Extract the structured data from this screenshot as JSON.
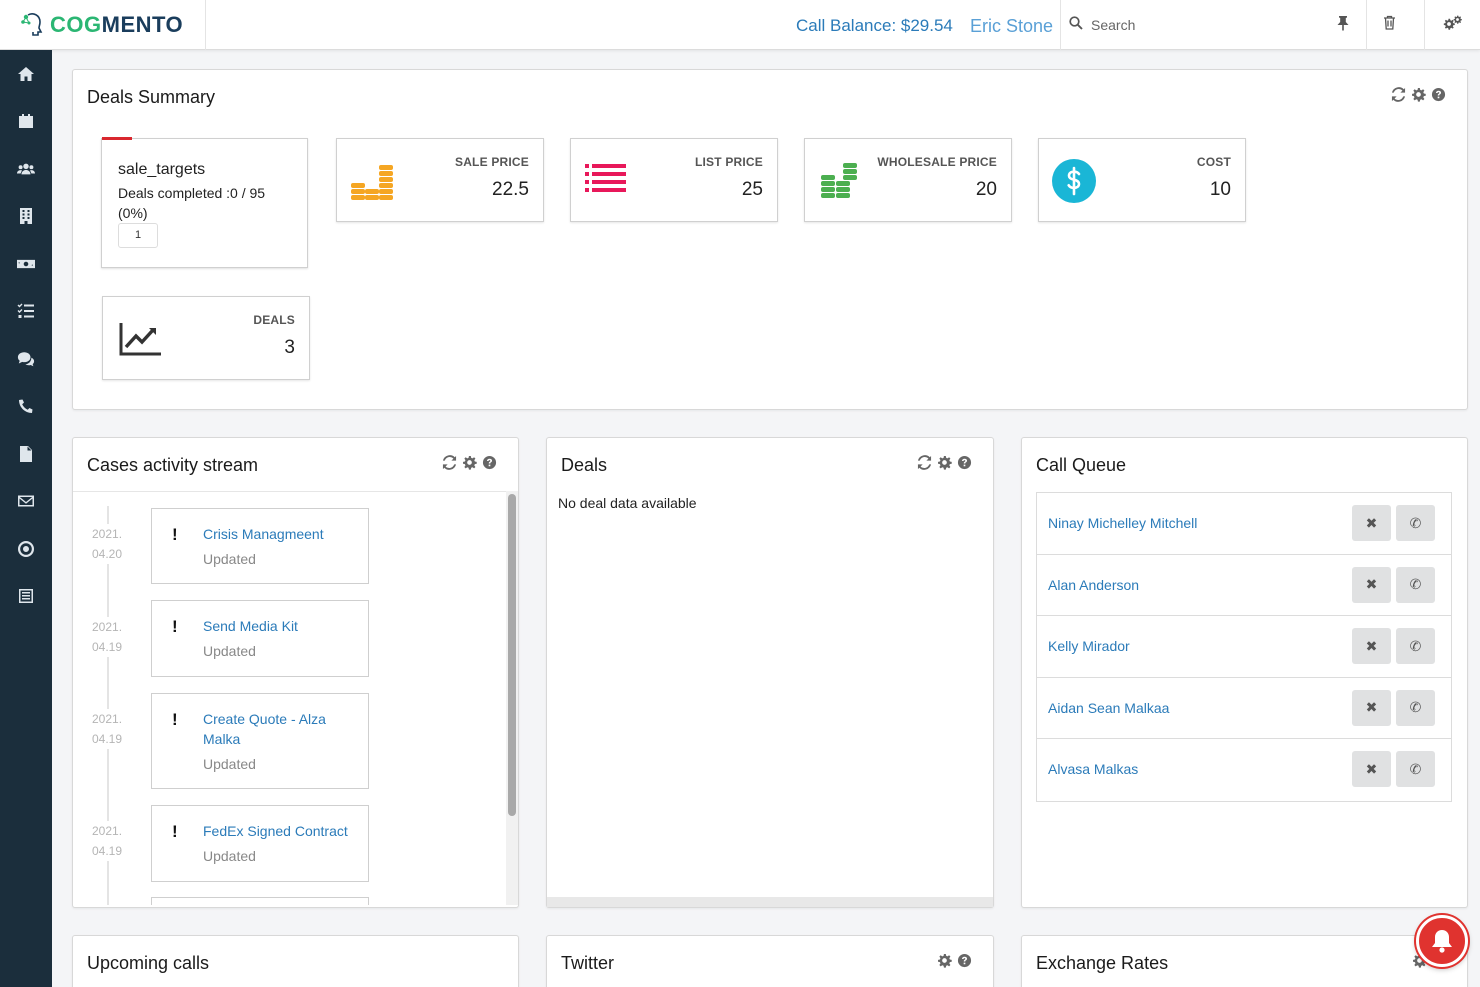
{
  "header": {
    "logo_cog": "COG",
    "logo_mento": "MENTO",
    "call_balance": "Call Balance: $29.54",
    "user_name": "Eric Stone",
    "search_placeholder": "Search"
  },
  "sidebar": {
    "items": [
      "home-icon",
      "calendar-icon",
      "contacts-icon",
      "companies-icon",
      "deals-icon",
      "tasks-icon",
      "cases-icon",
      "calls-icon",
      "documents-icon",
      "email-icon",
      "campaigns-icon",
      "forms-icon"
    ]
  },
  "deals_summary": {
    "title": "Deals Summary",
    "target": {
      "title": "sale_targets",
      "subtitle": "Deals completed :0 / 95 (0%)",
      "page": "1"
    },
    "cards": [
      {
        "label": "SALE PRICE",
        "value": "22.5",
        "icon": "coins-orange-icon"
      },
      {
        "label": "LIST PRICE",
        "value": "25",
        "icon": "list-icon"
      },
      {
        "label": "WHOLESALE PRICE",
        "value": "20",
        "icon": "coins-green-icon"
      },
      {
        "label": "COST",
        "value": "10",
        "icon": "dollar-circle-icon"
      },
      {
        "label": "DEALS",
        "value": "3",
        "icon": "line-chart-icon"
      }
    ],
    "colors": {
      "orange": "#f5a623",
      "pink": "#e8185a",
      "green": "#4caf50",
      "teal": "#1ab6d6"
    }
  },
  "cases_stream": {
    "title": "Cases activity stream",
    "items": [
      {
        "date_year": "2021.",
        "date_day": "04.20",
        "title": "Crisis Managmeent",
        "status": "Updated"
      },
      {
        "date_year": "2021.",
        "date_day": "04.19",
        "title": "Send Media Kit",
        "status": "Updated"
      },
      {
        "date_year": "2021.",
        "date_day": "04.19",
        "title": "Create Quote - Alza Malka",
        "status": "Updated"
      },
      {
        "date_year": "2021.",
        "date_day": "04.19",
        "title": "FedEx Signed Contract",
        "status": "Updated"
      }
    ]
  },
  "deals": {
    "title": "Deals",
    "empty_message": "No deal data available"
  },
  "call_queue": {
    "title": "Call Queue",
    "items": [
      {
        "name": "Ninay Michelley Mitchell"
      },
      {
        "name": "Alan Anderson"
      },
      {
        "name": "Kelly Mirador"
      },
      {
        "name": "Aidan Sean Malkaa"
      },
      {
        "name": "Alvasa Malkas"
      }
    ]
  },
  "bottom_panels": {
    "upcoming_calls": "Upcoming calls",
    "twitter": "Twitter",
    "exchange_rates": "Exchange Rates"
  }
}
